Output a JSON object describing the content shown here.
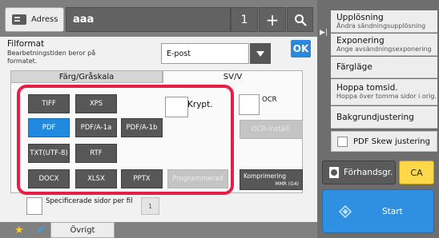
{
  "header": {
    "address_label": "Adress",
    "address_value": "aaa",
    "count": "1",
    "plus_glyph": "+"
  },
  "form": {
    "file_format_label": "Filformat",
    "file_format_sub": "Bearbetningstiden beror på formatet.",
    "file_format_value": "E-post",
    "ok_label": "OK",
    "tabs": {
      "color": "Färg/Gråskala",
      "bw": "SV/V"
    },
    "formats": {
      "tiff": "TIFF",
      "xps": "XPS",
      "pdf": "PDF",
      "pdfa1a": "PDF/A-1a",
      "pdfa1b": "PDF/A-1b",
      "txt": "TXT(UTF-8)",
      "rtf": "RTF",
      "docx": "DOCX",
      "xlsx": "XLSX",
      "pptx": "PPTX",
      "programmed": "Programmerad"
    },
    "selected_format": "PDF",
    "encrypt_label": "Krypt.",
    "ocr_label": "OCR",
    "ocr_settings_label": "OCR-inställ.",
    "compression_label": "Komprimering",
    "compression_value": "MMR (G4)",
    "specified_pages_label": "Specificerade sidor per fil",
    "specified_pages_value": "1"
  },
  "sidebar": {
    "items": [
      {
        "title": "Upplösning",
        "sub": "Ändra sändningsupplösning"
      },
      {
        "title": "Exponering",
        "sub": "Ange avsändningsexponering"
      },
      {
        "title": "Färgläge",
        "sub": ""
      },
      {
        "title": "Hoppa tomsid.",
        "sub": "Hoppa över tomma sidor i orig."
      },
      {
        "title": "Bakgrundjustering",
        "sub": ""
      }
    ],
    "skew_label": "PDF Skew justering",
    "preview_label": "Förhandsgr.",
    "ca_label": "CA",
    "start_label": "Start"
  },
  "footer": {
    "other_label": "Övrigt"
  },
  "colors": {
    "accent_blue": "#1f8ae0",
    "highlight_red": "#e71f47",
    "ca_yellow": "#ffd84a",
    "star_yellow": "#ffcd25"
  },
  "icons": {
    "address": "address-book-icon",
    "search": "search-icon",
    "dropdown": "caret-down-icon",
    "preview": "preview-icon",
    "start": "start-icon",
    "favorite": "star-icon",
    "check": "check-icon",
    "panel_toggle": "panel-toggle-icon"
  }
}
